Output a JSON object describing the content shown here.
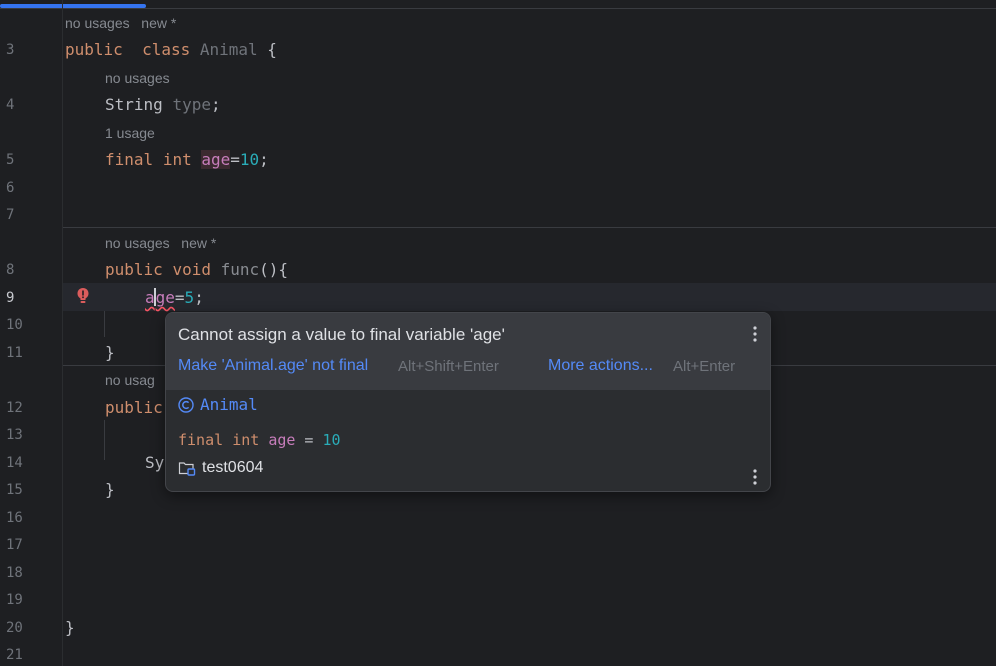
{
  "editor": {
    "line_numbers": [
      "3",
      "4",
      "5",
      "6",
      "7",
      "8",
      "9",
      "10",
      "11",
      "12",
      "13",
      "14",
      "15",
      "16",
      "17",
      "18",
      "19",
      "20",
      "21"
    ],
    "current_line": "9",
    "hints": {
      "class_usages": "no usages",
      "class_new": "new *",
      "type_usages": "no usages",
      "age_usages": "1 usage",
      "func_usages": "no usages",
      "func_new": "new *",
      "next_usages": "no usag"
    },
    "code": {
      "l3_kw1": "public",
      "l3_kw2": "class",
      "l3_cls": "Animal",
      "l3_brace": " {",
      "l4_type": "String",
      "l4_field": "type",
      "l4_semi": ";",
      "l5_kw1": "final",
      "l5_kw2": "int",
      "l5_field": "age",
      "l5_eq": "=",
      "l5_num": "10",
      "l5_semi": ";",
      "l8_kw1": "public",
      "l8_kw2": "void",
      "l8_meth": "func",
      "l8_rest": "(){",
      "l9_a": "a",
      "l9_rest": "ge",
      "l9_eq": "=",
      "l9_num": "5",
      "l9_semi": ";",
      "l11_brace": "}",
      "l12_kw": "public",
      "l14_text": "Sy",
      "l15_brace": "}",
      "l20_brace": "}"
    }
  },
  "icons": {
    "error_bulb": "error-bulb-icon",
    "class": "class-icon",
    "module": "module-folder-icon",
    "more": "more-vertical-icon"
  },
  "colors": {
    "keyword": "#cf8e6d",
    "field": "#c77dbb",
    "number": "#2aacb8",
    "link": "#548af7",
    "error": "#f75464"
  },
  "progress": {
    "fraction": 0.147
  },
  "popup": {
    "message": "Cannot assign a value to final variable 'age'",
    "fix_label": "Make 'Animal.age' not final",
    "fix_shortcut": "Alt+Shift+Enter",
    "more_label": "More actions...",
    "more_shortcut": "Alt+Enter",
    "class_name": "Animal",
    "decl_kw1": "final",
    "decl_kw2": "int",
    "decl_field": "age",
    "decl_eq": " = ",
    "decl_value": "10",
    "module_name": "test0604"
  }
}
